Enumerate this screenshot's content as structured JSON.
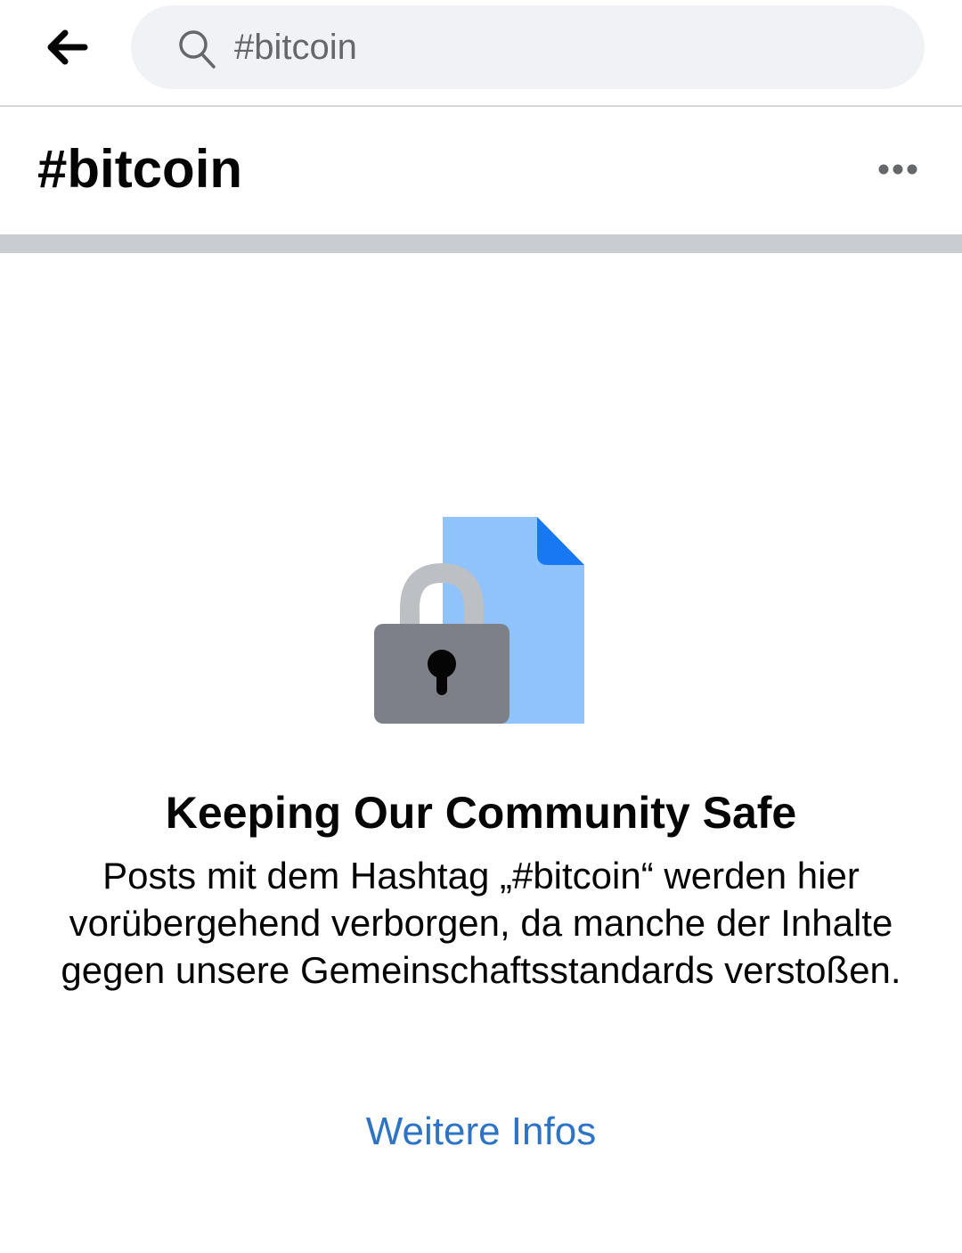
{
  "search": {
    "query": "#bitcoin",
    "icon": "search-icon"
  },
  "nav": {
    "back_icon": "back-arrow-icon"
  },
  "header": {
    "title": "#bitcoin",
    "more_icon": "more-options-icon"
  },
  "notice": {
    "illustration": "lock-document-icon",
    "title": "Keeping Our Community Safe",
    "body": "Posts mit dem Hashtag „#bitcoin“ werden hier vorübergehend verborgen, da manche der Inhalte gegen unsere Gemeinschaftsstandards verstoßen.",
    "learn_more_label": "Weitere Infos"
  },
  "colors": {
    "link": "#2d74c6",
    "search_bg": "#f0f2f5",
    "divider": "#c9ccd1",
    "document_blue": "#90c3fb",
    "document_fold": "#1877f2",
    "lock_body": "#7d8087",
    "lock_shackle": "#bcc0c4"
  }
}
